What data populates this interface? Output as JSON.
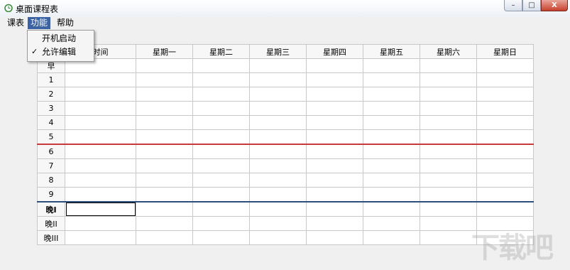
{
  "window": {
    "title": "桌面课程表",
    "icon": "clock-app-icon",
    "buttons": {
      "minimize": "–",
      "maximize": "□",
      "close": "X"
    }
  },
  "menubar": {
    "items": [
      "课表",
      "功能",
      "帮助"
    ],
    "active": "功能"
  },
  "dropdown": {
    "items": [
      {
        "label": "开机启动",
        "checked": false
      },
      {
        "label": "允许编辑",
        "checked": true
      }
    ],
    "check_glyph": "✓"
  },
  "table": {
    "corner_label": "时间",
    "days": [
      "星期一",
      "星期二",
      "星期三",
      "星期四",
      "星期五",
      "星期六",
      "星期日"
    ],
    "rows": [
      "早",
      "1",
      "2",
      "3",
      "4",
      "5",
      "6",
      "7",
      "8",
      "9",
      "晚I",
      "晚II",
      "晚III"
    ],
    "bold_row": "晚I",
    "colors": {
      "separator_after_5": "#c83a3a",
      "separator_after_9": "#2e4f7c"
    }
  },
  "watermark": "下载吧"
}
